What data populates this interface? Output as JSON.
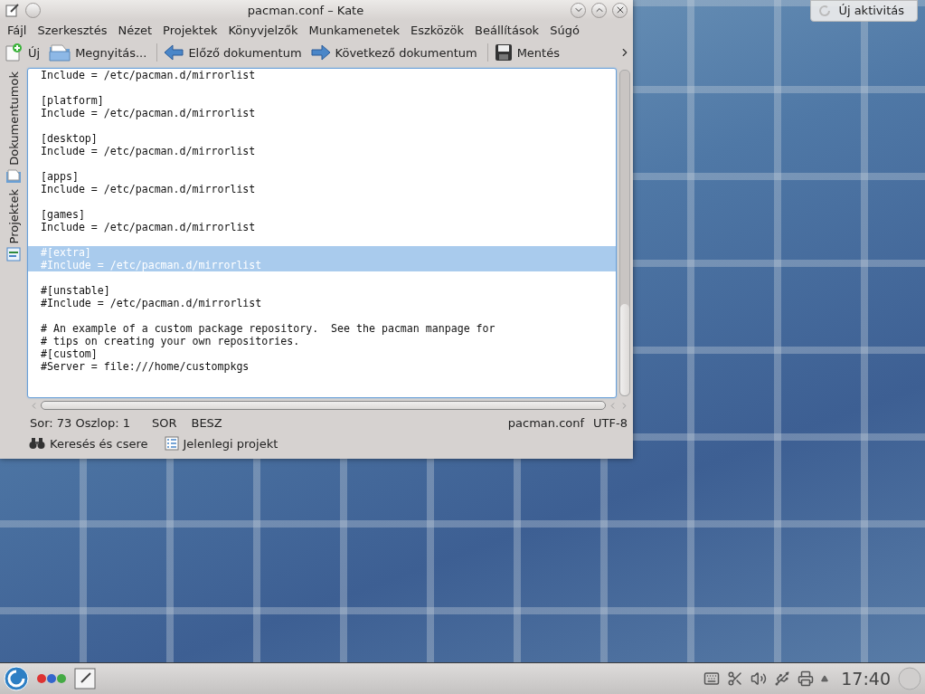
{
  "window": {
    "title": "pacman.conf – Kate"
  },
  "menu": [
    "Fájl",
    "Szerkesztés",
    "Nézet",
    "Projektek",
    "Könyvjelzők",
    "Munkamenetek",
    "Eszközök",
    "Beállítások",
    "Súgó"
  ],
  "toolbar": [
    {
      "kind": "new",
      "label": "Új"
    },
    {
      "kind": "open",
      "label": "Megnyitás..."
    },
    {
      "kind": "prev",
      "label": "Előző dokumentum"
    },
    {
      "kind": "next",
      "label": "Következő dokumentum"
    },
    {
      "kind": "save",
      "label": "Mentés"
    }
  ],
  "side_tabs": [
    {
      "kind": "documents",
      "label": "Dokumentumok"
    },
    {
      "kind": "projects",
      "label": "Projektek"
    }
  ],
  "editor": {
    "lines": [
      {
        "kind": "code",
        "text": "Include = /etc/pacman.d/mirrorlist",
        "selected": false
      },
      {
        "kind": "blank"
      },
      {
        "kind": "code",
        "text": "[platform]",
        "selected": false
      },
      {
        "kind": "code",
        "text": "Include = /etc/pacman.d/mirrorlist",
        "selected": false
      },
      {
        "kind": "blank"
      },
      {
        "kind": "code",
        "text": "[desktop]",
        "selected": false
      },
      {
        "kind": "code",
        "text": "Include = /etc/pacman.d/mirrorlist",
        "selected": false
      },
      {
        "kind": "blank"
      },
      {
        "kind": "code",
        "text": "[apps]",
        "selected": false
      },
      {
        "kind": "code",
        "text": "Include = /etc/pacman.d/mirrorlist",
        "selected": false
      },
      {
        "kind": "blank"
      },
      {
        "kind": "code",
        "text": "[games]",
        "selected": false
      },
      {
        "kind": "code",
        "text": "Include = /etc/pacman.d/mirrorlist",
        "selected": false
      },
      {
        "kind": "blank"
      },
      {
        "kind": "code",
        "text": "#[extra]",
        "selected": true
      },
      {
        "kind": "code",
        "text": "#Include = /etc/pacman.d/mirrorlist",
        "selected": true
      },
      {
        "kind": "blank"
      },
      {
        "kind": "code",
        "text": "#[unstable]",
        "selected": false
      },
      {
        "kind": "code",
        "text": "#Include = /etc/pacman.d/mirrorlist",
        "selected": false
      },
      {
        "kind": "blank"
      },
      {
        "kind": "code",
        "text": "# An example of a custom package repository.  See the pacman manpage for",
        "selected": false
      },
      {
        "kind": "code",
        "text": "# tips on creating your own repositories.",
        "selected": false
      },
      {
        "kind": "code",
        "text": "#[custom]",
        "selected": false
      },
      {
        "kind": "code",
        "text": "#Server = file:///home/custompkgs",
        "selected": false
      }
    ]
  },
  "status_bar": {
    "position": "Sor: 73 Oszlop: 1",
    "mode": "SOR",
    "input": "BESZ",
    "file": "pacman.conf",
    "encoding": "UTF-8"
  },
  "bottom_tabs": [
    {
      "kind": "search",
      "label": "Keresés és csere"
    },
    {
      "kind": "project",
      "label": "Jelenlegi projekt"
    }
  ],
  "activity_button": "Új aktivitás",
  "taskbar": {
    "clock": "17:40"
  }
}
